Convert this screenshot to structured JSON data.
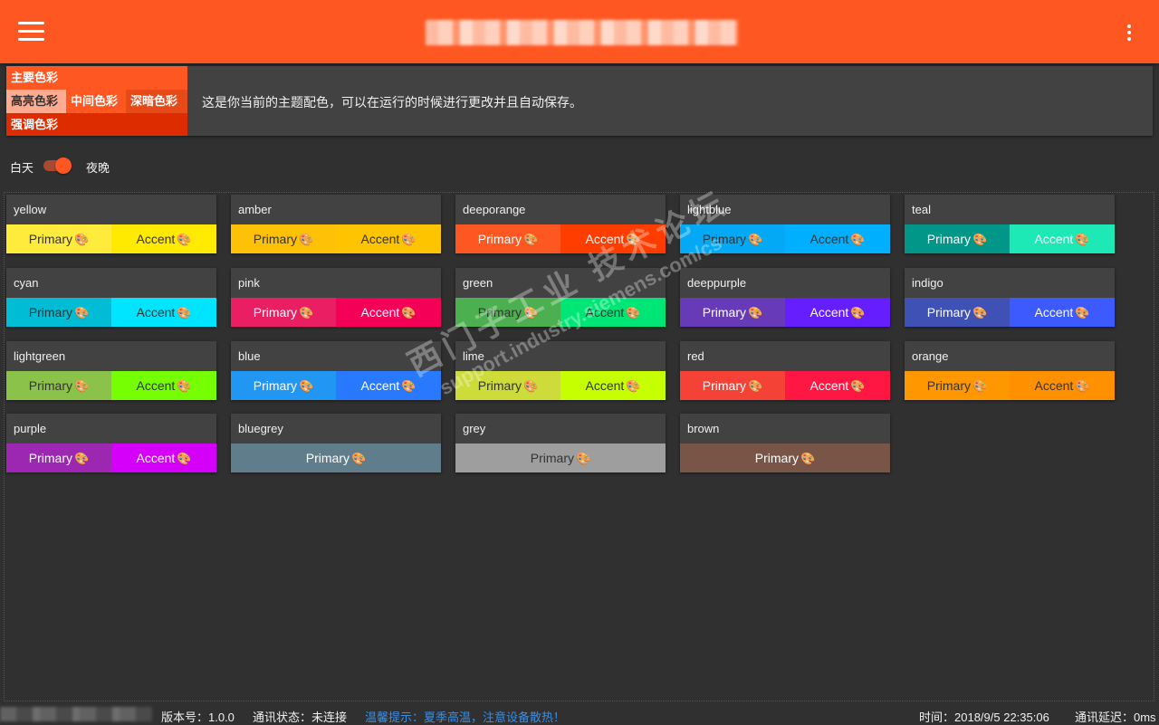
{
  "header": {
    "title_redacted": true
  },
  "theme": {
    "primary_label": "主要色彩",
    "light_label": "高亮色彩",
    "mid_label": "中间色彩",
    "dark_label": "深暗色彩",
    "accent_label": "强调色彩",
    "description": "这是你当前的主题配色，可以在运行的时候进行更改并且自动保存。",
    "colors": {
      "primary": "#ff5722",
      "light": "#ffab91",
      "mid": "#ff5722",
      "dark": "#e64a19",
      "accent": "#dd2c00"
    }
  },
  "mode": {
    "day_label": "白天",
    "night_label": "夜晚",
    "night_enabled": true
  },
  "palettes": [
    {
      "name": "yellow",
      "primary": "Primary",
      "accent": "Accent",
      "primary_color": "#ffeb3b",
      "accent_color": "#ffea00",
      "primary_text": "#333",
      "accent_text": "#333"
    },
    {
      "name": "amber",
      "primary": "Primary",
      "accent": "Accent",
      "primary_color": "#ffc107",
      "accent_color": "#ffc400",
      "primary_text": "#333",
      "accent_text": "#333"
    },
    {
      "name": "deeporange",
      "primary": "Primary",
      "accent": "Accent",
      "primary_color": "#ff5722",
      "accent_color": "#ff3d00",
      "primary_text": "#fff",
      "accent_text": "#fff"
    },
    {
      "name": "lightblue",
      "primary": "Primary",
      "accent": "Accent",
      "primary_color": "#03a9f4",
      "accent_color": "#00b0ff",
      "primary_text": "#333",
      "accent_text": "#333"
    },
    {
      "name": "teal",
      "primary": "Primary",
      "accent": "Accent",
      "primary_color": "#009688",
      "accent_color": "#1de9b6",
      "primary_text": "#fff",
      "accent_text": "#fff"
    },
    {
      "name": "cyan",
      "primary": "Primary",
      "accent": "Accent",
      "primary_color": "#00bcd4",
      "accent_color": "#00e5ff",
      "primary_text": "#333",
      "accent_text": "#333"
    },
    {
      "name": "pink",
      "primary": "Primary",
      "accent": "Accent",
      "primary_color": "#e91e63",
      "accent_color": "#f50057",
      "primary_text": "#fff",
      "accent_text": "#fff"
    },
    {
      "name": "green",
      "primary": "Primary",
      "accent": "Accent",
      "primary_color": "#4caf50",
      "accent_color": "#00e676",
      "primary_text": "#333",
      "accent_text": "#333"
    },
    {
      "name": "deeppurple",
      "primary": "Primary",
      "accent": "Accent",
      "primary_color": "#673ab7",
      "accent_color": "#651fff",
      "primary_text": "#fff",
      "accent_text": "#fff"
    },
    {
      "name": "indigo",
      "primary": "Primary",
      "accent": "Accent",
      "primary_color": "#3f51b5",
      "accent_color": "#3d5afe",
      "primary_text": "#fff",
      "accent_text": "#fff"
    },
    {
      "name": "lightgreen",
      "primary": "Primary",
      "accent": "Accent",
      "primary_color": "#8bc34a",
      "accent_color": "#76ff03",
      "primary_text": "#333",
      "accent_text": "#333"
    },
    {
      "name": "blue",
      "primary": "Primary",
      "accent": "Accent",
      "primary_color": "#2196f3",
      "accent_color": "#2979ff",
      "primary_text": "#fff",
      "accent_text": "#fff"
    },
    {
      "name": "lime",
      "primary": "Primary",
      "accent": "Accent",
      "primary_color": "#cddc39",
      "accent_color": "#c6ff00",
      "primary_text": "#333",
      "accent_text": "#333"
    },
    {
      "name": "red",
      "primary": "Primary",
      "accent": "Accent",
      "primary_color": "#f44336",
      "accent_color": "#ff1744",
      "primary_text": "#fff",
      "accent_text": "#fff"
    },
    {
      "name": "orange",
      "primary": "Primary",
      "accent": "Accent",
      "primary_color": "#ff9800",
      "accent_color": "#ff9100",
      "primary_text": "#333",
      "accent_text": "#333"
    },
    {
      "name": "purple",
      "primary": "Primary",
      "accent": "Accent",
      "primary_color": "#9c27b0",
      "accent_color": "#d500f9",
      "primary_text": "#fff",
      "accent_text": "#fff"
    },
    {
      "name": "bluegrey",
      "primary": "Primary",
      "primary_color": "#607d8b",
      "primary_text": "#fff"
    },
    {
      "name": "grey",
      "primary": "Primary",
      "primary_color": "#9e9e9e",
      "primary_text": "#333"
    },
    {
      "name": "brown",
      "primary": "Primary",
      "primary_color": "#795548",
      "primary_text": "#fff"
    }
  ],
  "icons": {
    "palette": "palette-icon",
    "menu": "menu-icon",
    "more": "more-vert-icon"
  },
  "watermark": {
    "line1": "西门子工业 技术论坛",
    "line2": "support.industry.siemens.com/cs"
  },
  "status": {
    "version": "版本号：1.0.0",
    "comm": "通讯状态：未连接",
    "tip": "温馨提示：夏季高温，注意设备散热！",
    "time": "时间：2018/9/5 22:35:06",
    "delay": "通讯延迟：0ms"
  }
}
